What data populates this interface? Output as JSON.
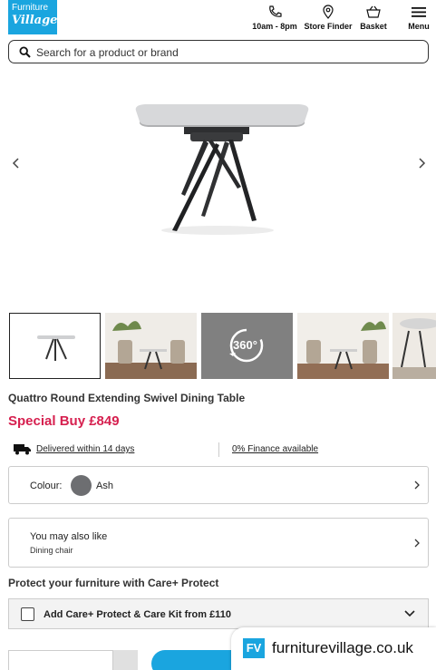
{
  "header": {
    "logo_line1": "Furniture",
    "logo_line2": "Village",
    "nav": [
      {
        "label": "10am - 8pm",
        "icon": "phone-icon"
      },
      {
        "label": "Store Finder",
        "icon": "location-pin-icon"
      },
      {
        "label": "Basket",
        "icon": "basket-icon"
      },
      {
        "label": "Menu",
        "icon": "hamburger-menu-icon"
      }
    ]
  },
  "search": {
    "placeholder": "Search for a product or brand",
    "icon": "search-icon"
  },
  "gallery": {
    "main_image": "extending-dining-table-product-image",
    "thumbnails": [
      {
        "icon": "table-thumbnail",
        "selected": true
      },
      {
        "icon": "room-scene-thumbnail",
        "selected": false
      },
      {
        "icon": "360-view-thumbnail",
        "label": "360°",
        "selected": false
      },
      {
        "icon": "room-scene-thumbnail",
        "selected": false
      },
      {
        "icon": "room-scene-thumbnail",
        "selected": false
      }
    ]
  },
  "product": {
    "title": "Quattro Round Extending Swivel Dining Table",
    "price": "Special Buy £849",
    "price_color": "#d6204f",
    "delivery": "Delivered within 14 days",
    "finance": "0% Finance available"
  },
  "colour": {
    "label": "Colour:",
    "value": "Ash",
    "swatch_color": "#6d6e71"
  },
  "also_like": {
    "heading": "You may also like",
    "sub": "Dining chair"
  },
  "protect": {
    "heading": "Protect your furniture with Care+ Protect",
    "option_label": "Add Care+ Protect & Care Kit from £110"
  },
  "watermark": {
    "badge": "FV",
    "url": "furniturevillage.co.uk"
  },
  "colors": {
    "brand_blue": "#1aa5df",
    "accent_red": "#d6204f"
  }
}
